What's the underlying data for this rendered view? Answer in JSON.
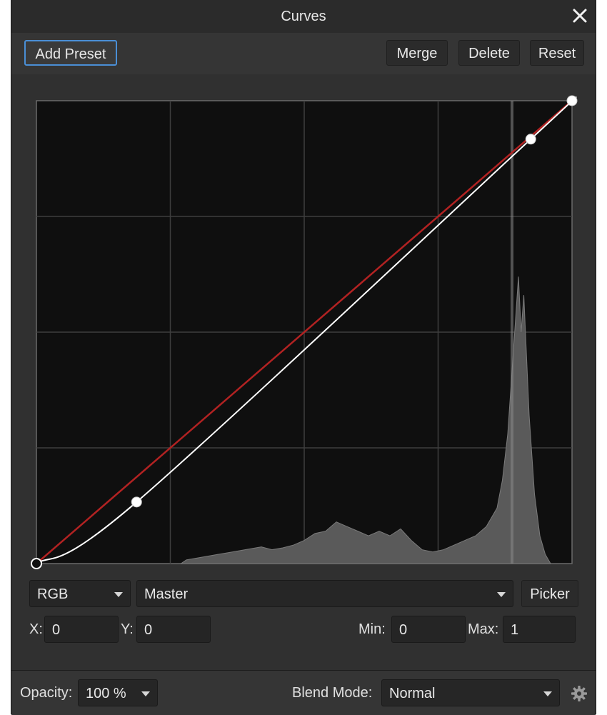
{
  "window": {
    "title": "Curves"
  },
  "toolbar": {
    "add_preset": "Add Preset",
    "merge": "Merge",
    "delete": "Delete",
    "reset": "Reset"
  },
  "colors": {
    "curve": "#ffffff",
    "diagonal": "#b22222",
    "histogram": "#5a5a5a",
    "accent": "#4a8fd6"
  },
  "curve": {
    "points": [
      {
        "x": 0.0,
        "y": 0.0
      },
      {
        "x": 0.187,
        "y": 0.133
      },
      {
        "x": 0.923,
        "y": 0.917
      },
      {
        "x": 1.0,
        "y": 1.0
      }
    ],
    "histogram": [
      [
        0.27,
        0.0
      ],
      [
        0.28,
        0.008
      ],
      [
        0.3,
        0.012
      ],
      [
        0.32,
        0.016
      ],
      [
        0.34,
        0.02
      ],
      [
        0.36,
        0.024
      ],
      [
        0.38,
        0.028
      ],
      [
        0.4,
        0.032
      ],
      [
        0.42,
        0.036
      ],
      [
        0.44,
        0.03
      ],
      [
        0.46,
        0.034
      ],
      [
        0.48,
        0.04
      ],
      [
        0.5,
        0.05
      ],
      [
        0.52,
        0.065
      ],
      [
        0.54,
        0.07
      ],
      [
        0.56,
        0.09
      ],
      [
        0.58,
        0.08
      ],
      [
        0.6,
        0.07
      ],
      [
        0.62,
        0.06
      ],
      [
        0.64,
        0.07
      ],
      [
        0.66,
        0.06
      ],
      [
        0.68,
        0.075
      ],
      [
        0.7,
        0.05
      ],
      [
        0.72,
        0.03
      ],
      [
        0.74,
        0.025
      ],
      [
        0.76,
        0.03
      ],
      [
        0.78,
        0.04
      ],
      [
        0.8,
        0.05
      ],
      [
        0.82,
        0.06
      ],
      [
        0.84,
        0.08
      ],
      [
        0.86,
        0.12
      ],
      [
        0.87,
        0.18
      ],
      [
        0.88,
        0.28
      ],
      [
        0.89,
        0.45
      ],
      [
        0.9,
        0.62
      ],
      [
        0.905,
        0.5
      ],
      [
        0.91,
        0.58
      ],
      [
        0.915,
        0.45
      ],
      [
        0.92,
        0.32
      ],
      [
        0.93,
        0.15
      ],
      [
        0.94,
        0.06
      ],
      [
        0.95,
        0.02
      ],
      [
        0.96,
        0.0
      ]
    ]
  },
  "channel": {
    "selected": "RGB"
  },
  "mode": {
    "selected": "Master"
  },
  "picker": "Picker",
  "fields": {
    "x_label": "X:",
    "x_value": "0",
    "y_label": "Y:",
    "y_value": "0",
    "min_label": "Min:",
    "min_value": "0",
    "max_label": "Max:",
    "max_value": "1"
  },
  "footer": {
    "opacity_label": "Opacity:",
    "opacity_value": "100 %",
    "blend_label": "Blend Mode:",
    "blend_value": "Normal"
  },
  "icons": {
    "close": "close-icon",
    "settings": "gear-icon",
    "dropdown": "chevron-down-icon"
  }
}
